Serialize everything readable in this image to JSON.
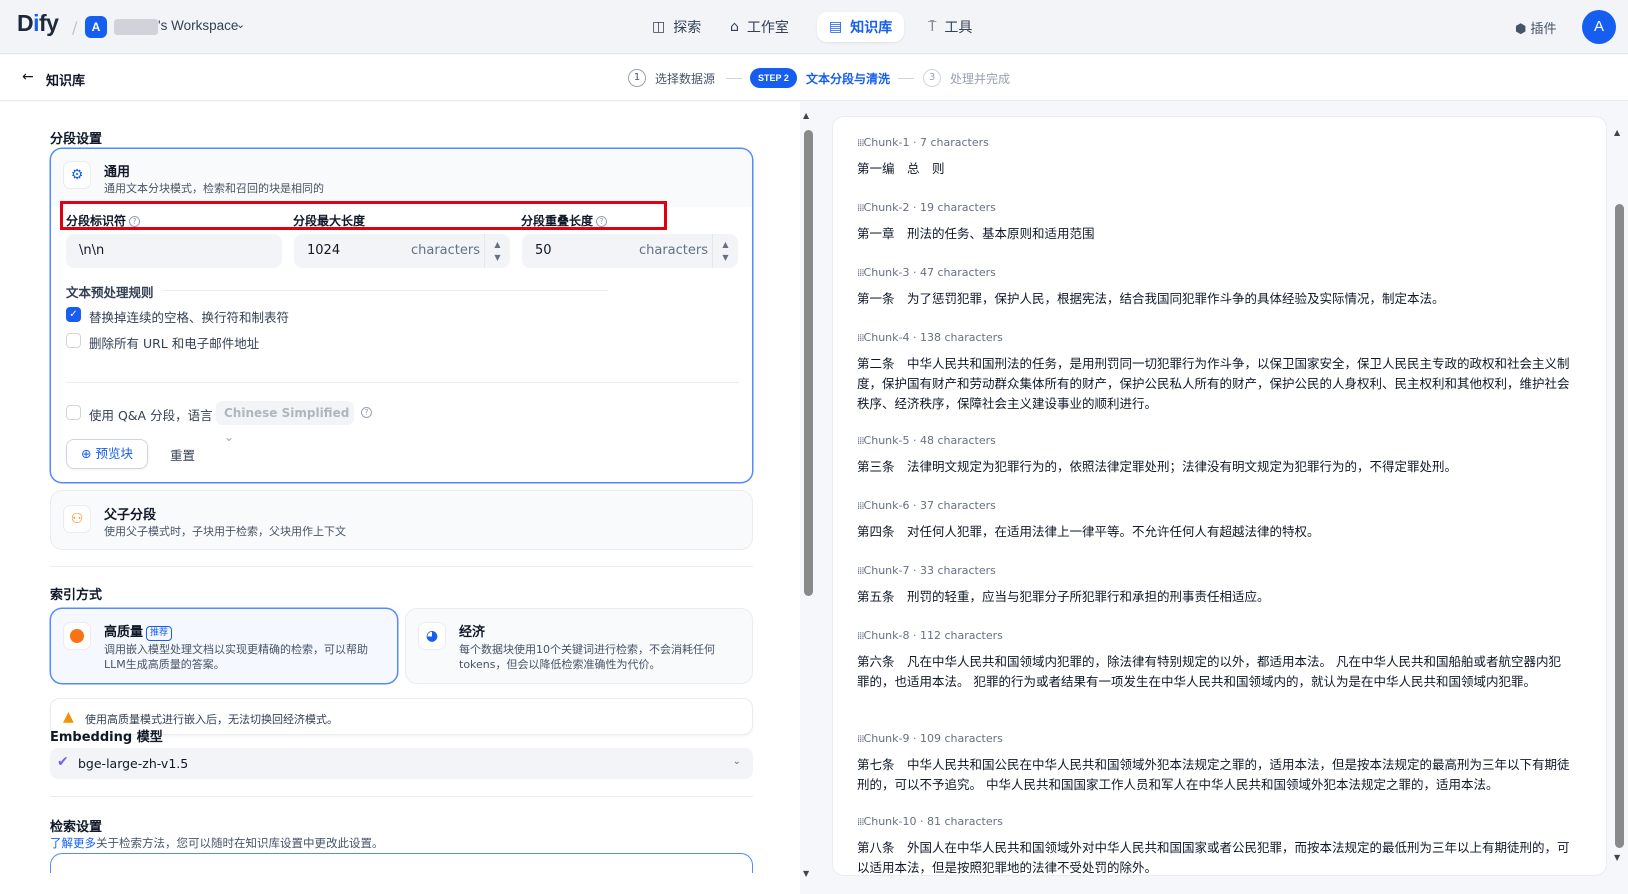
{
  "topbar": {
    "logo_prefix": "D",
    "logo_accent": "i",
    "logo_suffix": "fy",
    "workspace_avatar": "A",
    "workspace_name": "'s Workspace",
    "nav": [
      {
        "label": "探索",
        "icon": "compass-icon"
      },
      {
        "label": "工作室",
        "icon": "robot-icon"
      },
      {
        "label": "知识库",
        "icon": "book-icon"
      },
      {
        "label": "工具",
        "icon": "hammer-icon"
      }
    ],
    "plugin_label": "插件",
    "user_avatar": "A"
  },
  "subheader": {
    "back_label": "知识库",
    "steps": [
      {
        "num": "1",
        "label": "选择数据源"
      },
      {
        "num": "STEP 2",
        "label": "文本分段与清洗"
      },
      {
        "num": "3",
        "label": "处理并完成"
      }
    ]
  },
  "segment": {
    "section_title": "分段设置",
    "general": {
      "title": "通用",
      "desc": "通用文本分块模式，检索和召回的块是相同的",
      "separator_label": "分段标识符",
      "separator_value": "\\n\\n",
      "maxlen_label": "分段最大长度",
      "maxlen_value": "1024",
      "maxlen_unit": "characters",
      "overlap_label": "分段重叠长度",
      "overlap_value": "50",
      "overlap_unit": "characters",
      "rules_title": "文本预处理规则",
      "rule_1": "替换掉连续的空格、换行符和制表符",
      "rule_2": "删除所有 URL 和电子邮件地址",
      "qa_label": "使用 Q&A 分段，语言",
      "qa_language": "Chinese Simplified",
      "preview_button": "预览块",
      "reset_button": "重置"
    },
    "parent_child": {
      "title": "父子分段",
      "desc": "使用父子模式时，子块用于检索，父块用作上下文"
    }
  },
  "index": {
    "section_title": "索引方式",
    "high_quality": {
      "title": "高质量",
      "badge": "推荐",
      "desc_1": "调用嵌入模型处理文档以实现更精确的检索，可以帮助",
      "desc_2": "LLM生成高质量的答案。"
    },
    "economy": {
      "title": "经济",
      "desc_1": "每个数据块使用10个关键词进行检索，不会消耗任何",
      "desc_2": "tokens，但会以降低检索准确性为代价。"
    },
    "warning": "使用高质量模式进行嵌入后，无法切换回经济模式。"
  },
  "embedding": {
    "section_title": "Embedding 模型",
    "model": "bge-large-zh-v1.5"
  },
  "retrieval": {
    "section_title": "检索设置",
    "link": "了解更多",
    "desc": "关于检索方法，您可以随时在知识库设置中更改此设置。"
  },
  "chunks": [
    {
      "meta": "Chunk-1 · 7 characters",
      "text": "第一编　总　则"
    },
    {
      "meta": "Chunk-2 · 19 characters",
      "text": "第一章　刑法的任务、基本原则和适用范围"
    },
    {
      "meta": "Chunk-3 · 47 characters",
      "text": "第一条　为了惩罚犯罪，保护人民，根据宪法，结合我国同犯罪作斗争的具体经验及实际情况，制定本法。"
    },
    {
      "meta": "Chunk-4 · 138 characters",
      "text": "第二条　中华人民共和国刑法的任务，是用刑罚同一切犯罪行为作斗争，以保卫国家安全，保卫人民民主专政的政权和社会主义制度，保护国有财产和劳动群众集体所有的财产，保护公民私人所有的财产，保护公民的人身权利、民主权利和其他权利，维护社会秩序、经济秩序，保障社会主义建设事业的顺利进行。"
    },
    {
      "meta": "Chunk-5 · 48 characters",
      "text": "第三条　法律明文规定为犯罪行为的，依照法律定罪处刑；法律没有明文规定为犯罪行为的，不得定罪处刑。"
    },
    {
      "meta": "Chunk-6 · 37 characters",
      "text": "第四条　对任何人犯罪，在适用法律上一律平等。不允许任何人有超越法律的特权。"
    },
    {
      "meta": "Chunk-7 · 33 characters",
      "text": "第五条　刑罚的轻重，应当与犯罪分子所犯罪行和承担的刑事责任相适应。"
    },
    {
      "meta": "Chunk-8 · 112 characters",
      "text": "第六条　凡在中华人民共和国领域内犯罪的，除法律有特别规定的以外，都适用本法。 凡在中华人民共和国船舶或者航空器内犯罪的，也适用本法。 犯罪的行为或者结果有一项发生在中华人民共和国领域内的，就认为是在中华人民共和国领域内犯罪。"
    },
    {
      "meta": "Chunk-9 · 109 characters",
      "text": "第七条　中华人民共和国公民在中华人民共和国领域外犯本法规定之罪的，适用本法，但是按本法规定的最高刑为三年以下有期徒刑的，可以不予追究。 中华人民共和国国家工作人员和军人在中华人民共和国领域外犯本法规定之罪的，适用本法。"
    },
    {
      "meta": "Chunk-10 · 81 characters",
      "text": "第八条　外国人在中华人民共和国领域外对中华人民共和国国家或者公民犯罪，而按本法规定的最低刑为三年以上有期徒刑的，可以适用本法，但是按照犯罪地的法律不受处罚的除外。"
    }
  ]
}
